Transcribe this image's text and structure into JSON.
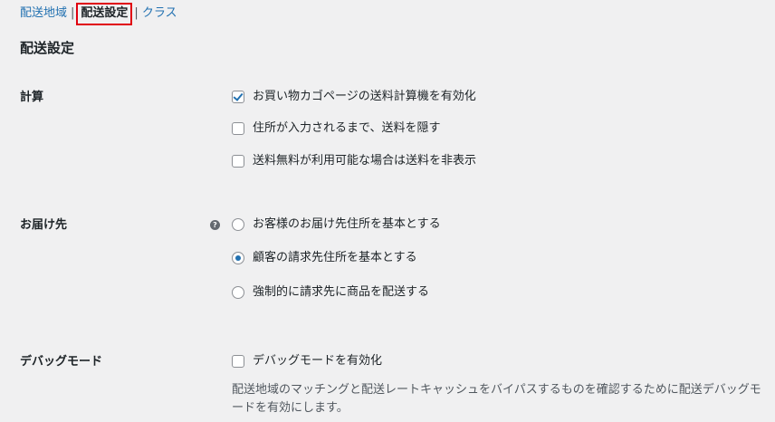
{
  "subnav": {
    "zones_label": "配送地域",
    "sep1": "|",
    "options_label": "配送設定",
    "sep2": "|",
    "classes_label": "クラス"
  },
  "page_title": "配送設定",
  "calc": {
    "label": "計算",
    "options": [
      {
        "label": "お買い物カゴページの送料計算機を有効化",
        "checked": true
      },
      {
        "label": "住所が入力されるまで、送料を隠す",
        "checked": false
      },
      {
        "label": "送料無料が利用可能な場合は送料を非表示",
        "checked": false
      }
    ]
  },
  "destination": {
    "label": "お届け先",
    "help_glyph": "?",
    "options": [
      {
        "label": "お客様のお届け先住所を基本とする",
        "checked": false
      },
      {
        "label": "顧客の請求先住所を基本とする",
        "checked": true
      },
      {
        "label": "強制的に請求先に商品を配送する",
        "checked": false
      }
    ]
  },
  "debug": {
    "label": "デバッグモード",
    "option": {
      "label": "デバッグモードを有効化",
      "checked": false
    },
    "description": "配送地域のマッチングと配送レートキャッシュをバイパスするものを確認するために配送デバッグモードを有効にします。"
  }
}
